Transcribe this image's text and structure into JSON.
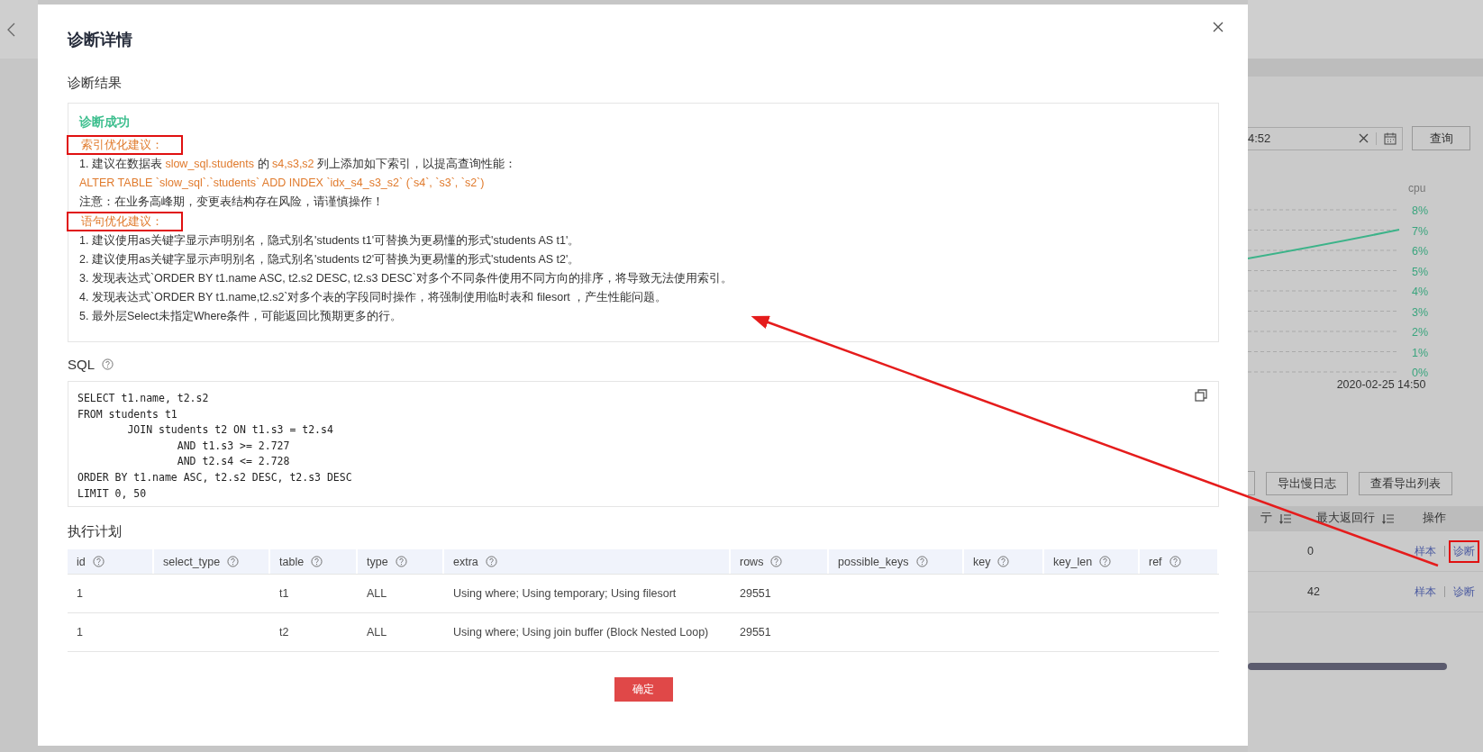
{
  "background": {
    "search": {
      "value": "4:52"
    },
    "query_button": "查询",
    "chart": {
      "ylabel": "cpu",
      "ticks": [
        "8%",
        "7%",
        "6%",
        "5%",
        "4%",
        "3%",
        "2%",
        "1%",
        "0%"
      ],
      "date": "2020-02-25 14:50"
    },
    "buttons": [
      "导出慢日志",
      "查看导出列表"
    ],
    "table": {
      "columns": [
        {
          "label": "亍",
          "sortable": true
        },
        {
          "label": "最大返回行",
          "sortable": true
        },
        {
          "label": "操作",
          "sortable": false
        }
      ],
      "rows": [
        {
          "value": "0",
          "actions": [
            {
              "label": "样本",
              "highlighted": false
            },
            {
              "label": "诊断",
              "highlighted": true
            }
          ]
        },
        {
          "value": "42",
          "actions": [
            {
              "label": "样本",
              "highlighted": false
            },
            {
              "label": "诊断",
              "highlighted": false
            }
          ]
        }
      ]
    }
  },
  "dialog": {
    "title": "诊断详情",
    "result_heading": "诊断结果",
    "status": "诊断成功",
    "sections": [
      {
        "heading": "索引优化建议：",
        "highlighted": true,
        "lines": [
          {
            "segments": [
              {
                "text": "1. 建议在数据表 ",
                "emphasis": false
              },
              {
                "text": "slow_sql.students",
                "emphasis": true
              },
              {
                "text": " 的 ",
                "emphasis": false
              },
              {
                "text": "s4,s3,s2",
                "emphasis": true
              },
              {
                "text": " 列上添加如下索引，以提高查询性能：",
                "emphasis": false
              }
            ]
          },
          {
            "segments": [
              {
                "text": "ALTER TABLE `slow_sql`.`students` ADD INDEX `idx_s4_s3_s2` (`s4`, `s3`, `s2`)",
                "emphasis": true
              }
            ]
          },
          {
            "segments": [
              {
                "text": "注意：在业务高峰期，变更表结构存在风险，请谨慎操作！",
                "emphasis": false
              }
            ]
          }
        ]
      },
      {
        "heading": "语句优化建议：",
        "highlighted": true,
        "lines": [
          {
            "segments": [
              {
                "text": "1. 建议使用as关键字显示声明别名，隐式别名'students t1'可替换为更易懂的形式'students AS t1'。",
                "emphasis": false
              }
            ]
          },
          {
            "segments": [
              {
                "text": "2. 建议使用as关键字显示声明别名，隐式别名'students t2'可替换为更易懂的形式'students AS t2'。",
                "emphasis": false
              }
            ]
          },
          {
            "segments": [
              {
                "text": "3. 发现表达式`ORDER BY t1.name ASC, t2.s2 DESC, t2.s3 DESC`对多个不同条件使用不同方向的排序，将导致无法使用索引。",
                "emphasis": false
              }
            ]
          },
          {
            "segments": [
              {
                "text": "4. 发现表达式`ORDER BY t1.name,t2.s2`对多个表的字段同时操作，将强制使用临时表和 filesort ，产生性能问题。",
                "emphasis": false
              }
            ]
          },
          {
            "segments": [
              {
                "text": "5. 最外层Select未指定Where条件，可能返回比预期更多的行。",
                "emphasis": false
              }
            ]
          }
        ]
      }
    ],
    "sql_heading": "SQL",
    "sql": "SELECT t1.name, t2.s2\nFROM students t1\n        JOIN students t2 ON t1.s3 = t2.s4\n                AND t1.s3 >= 2.727\n                AND t2.s4 <= 2.728\nORDER BY t1.name ASC, t2.s2 DESC, t2.s3 DESC\nLIMIT 0, 50",
    "plan_heading": "执行计划",
    "plan": {
      "columns": [
        "id",
        "select_type",
        "table",
        "type",
        "extra",
        "rows",
        "possible_keys",
        "key",
        "key_len",
        "ref"
      ],
      "rows": [
        {
          "cells": [
            "1",
            null,
            "t1",
            "ALL",
            "Using where; Using temporary; Using filesort",
            "29551",
            null,
            null,
            null,
            null
          ]
        },
        {
          "cells": [
            "1",
            null,
            "t2",
            "ALL",
            "Using where; Using join buffer (Block Nested Loop)",
            "29551",
            null,
            null,
            null,
            null
          ]
        }
      ]
    },
    "confirm_button": "确定"
  }
}
